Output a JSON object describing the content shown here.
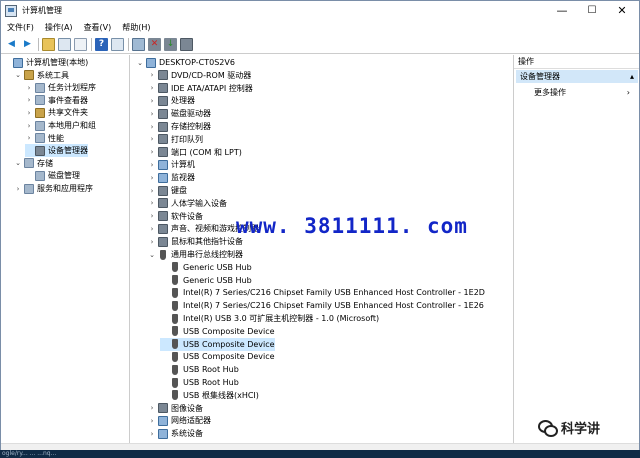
{
  "window": {
    "title": "计算机管理",
    "controls": {
      "minimize": "—",
      "maximize": "☐",
      "close": "✕"
    }
  },
  "menu": [
    "文件(F)",
    "操作(A)",
    "查看(V)",
    "帮助(H)"
  ],
  "toolbar": [
    "back-icon",
    "forward-icon",
    "up-folder-icon",
    "show-tree-icon",
    "properties-icon",
    "help-icon",
    "view-icon",
    "scan-hardware-icon",
    "disable-device-icon",
    "uninstall-device-icon",
    "update-driver-icon"
  ],
  "left_tree": [
    {
      "label": "计算机管理(本地)",
      "level": 0,
      "expander": "",
      "icon": "comp",
      "selected": false
    },
    {
      "label": "系统工具",
      "level": 1,
      "expander": "⌄",
      "icon": "tool",
      "selected": false
    },
    {
      "label": "任务计划程序",
      "level": 2,
      "expander": "›",
      "icon": "gen",
      "selected": false
    },
    {
      "label": "事件查看器",
      "level": 2,
      "expander": "›",
      "icon": "gen",
      "selected": false
    },
    {
      "label": "共享文件夹",
      "level": 2,
      "expander": "›",
      "icon": "tool",
      "selected": false
    },
    {
      "label": "本地用户和组",
      "level": 2,
      "expander": "›",
      "icon": "gen",
      "selected": false
    },
    {
      "label": "性能",
      "level": 2,
      "expander": "›",
      "icon": "gen",
      "selected": false
    },
    {
      "label": "设备管理器",
      "level": 2,
      "expander": "",
      "icon": "dev",
      "selected": true
    },
    {
      "label": "存储",
      "level": 1,
      "expander": "⌄",
      "icon": "gen",
      "selected": false
    },
    {
      "label": "磁盘管理",
      "level": 2,
      "expander": "",
      "icon": "gen",
      "selected": false
    },
    {
      "label": "服务和应用程序",
      "level": 1,
      "expander": "›",
      "icon": "gen",
      "selected": false
    }
  ],
  "device_tree": [
    {
      "label": "DESKTOP-CT0S2V6",
      "level": 0,
      "expander": "⌄",
      "icon": "comp",
      "selected": false
    },
    {
      "label": "DVD/CD-ROM 驱动器",
      "level": 1,
      "expander": "›",
      "icon": "dev",
      "selected": false
    },
    {
      "label": "IDE ATA/ATAPI 控制器",
      "level": 1,
      "expander": "›",
      "icon": "dev",
      "selected": false
    },
    {
      "label": "处理器",
      "level": 1,
      "expander": "›",
      "icon": "dev",
      "selected": false
    },
    {
      "label": "磁盘驱动器",
      "level": 1,
      "expander": "›",
      "icon": "dev",
      "selected": false
    },
    {
      "label": "存储控制器",
      "level": 1,
      "expander": "›",
      "icon": "dev",
      "selected": false
    },
    {
      "label": "打印队列",
      "level": 1,
      "expander": "›",
      "icon": "dev",
      "selected": false
    },
    {
      "label": "端口 (COM 和 LPT)",
      "level": 1,
      "expander": "›",
      "icon": "dev",
      "selected": false
    },
    {
      "label": "计算机",
      "level": 1,
      "expander": "›",
      "icon": "comp",
      "selected": false
    },
    {
      "label": "监视器",
      "level": 1,
      "expander": "›",
      "icon": "comp",
      "selected": false
    },
    {
      "label": "键盘",
      "level": 1,
      "expander": "›",
      "icon": "dev",
      "selected": false
    },
    {
      "label": "人体学输入设备",
      "level": 1,
      "expander": "›",
      "icon": "dev",
      "selected": false
    },
    {
      "label": "软件设备",
      "level": 1,
      "expander": "›",
      "icon": "dev",
      "selected": false
    },
    {
      "label": "声音、视频和游戏控制器",
      "level": 1,
      "expander": "›",
      "icon": "dev",
      "selected": false
    },
    {
      "label": "鼠标和其他指针设备",
      "level": 1,
      "expander": "›",
      "icon": "dev",
      "selected": false
    },
    {
      "label": "通用串行总线控制器",
      "level": 1,
      "expander": "⌄",
      "icon": "usb",
      "selected": false
    },
    {
      "label": "Generic USB Hub",
      "level": 2,
      "expander": "",
      "icon": "usb",
      "selected": false
    },
    {
      "label": "Generic USB Hub",
      "level": 2,
      "expander": "",
      "icon": "usb",
      "selected": false
    },
    {
      "label": "Intel(R) 7 Series/C216 Chipset Family USB Enhanced Host Controller - 1E2D",
      "level": 2,
      "expander": "",
      "icon": "usb",
      "selected": false
    },
    {
      "label": "Intel(R) 7 Series/C216 Chipset Family USB Enhanced Host Controller - 1E26",
      "level": 2,
      "expander": "",
      "icon": "usb",
      "selected": false
    },
    {
      "label": "Intel(R) USB 3.0 可扩展主机控制器 - 1.0 (Microsoft)",
      "level": 2,
      "expander": "",
      "icon": "usb",
      "selected": false
    },
    {
      "label": "USB Composite Device",
      "level": 2,
      "expander": "",
      "icon": "usb",
      "selected": false
    },
    {
      "label": "USB Composite Device",
      "level": 2,
      "expander": "",
      "icon": "usb",
      "selected": true
    },
    {
      "label": "USB Composite Device",
      "level": 2,
      "expander": "",
      "icon": "usb",
      "selected": false
    },
    {
      "label": "USB Root Hub",
      "level": 2,
      "expander": "",
      "icon": "usb",
      "selected": false
    },
    {
      "label": "USB Root Hub",
      "level": 2,
      "expander": "",
      "icon": "usb",
      "selected": false
    },
    {
      "label": "USB 根集线器(xHCI)",
      "level": 2,
      "expander": "",
      "icon": "usb",
      "selected": false
    },
    {
      "label": "图像设备",
      "level": 1,
      "expander": "›",
      "icon": "dev",
      "selected": false
    },
    {
      "label": "网络适配器",
      "level": 1,
      "expander": "›",
      "icon": "comp",
      "selected": false
    },
    {
      "label": "系统设备",
      "level": 1,
      "expander": "›",
      "icon": "comp",
      "selected": false
    }
  ],
  "actions": {
    "header": "操作",
    "section": "设备管理器",
    "section_arrow": "▴",
    "more": "更多操作",
    "more_arrow": "›"
  },
  "overlay": {
    "watermark": "www. 3811111. com",
    "brand": "科学讲"
  },
  "taskbar_fragment": "ogle/ry... ... ...nq...",
  "colors": {
    "selection": "#cce8ff",
    "action_selected": "#d2e7f9",
    "watermark": "#1226c7"
  }
}
